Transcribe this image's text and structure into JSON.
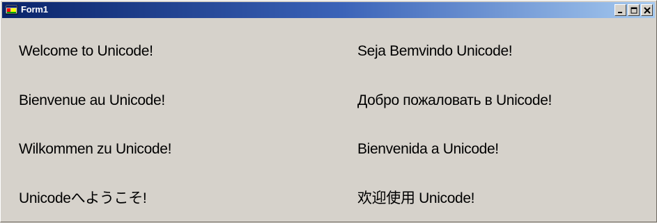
{
  "window": {
    "title": "Form1",
    "icon": "app-form-icon",
    "controls": {
      "minimize_icon": "minimize-icon",
      "maximize_icon": "maximize-icon",
      "close_icon": "close-icon"
    }
  },
  "greetings": {
    "left": [
      "Welcome to Unicode!",
      "Bienvenue au Unicode!",
      "Wilkommen zu Unicode!",
      "Unicodeへようこそ!"
    ],
    "right": [
      "Seja Bemvindo Unicode!",
      "Добро пожаловать в Unicode!",
      "Bienvenida a Unicode!",
      "欢迎使用 Unicode!"
    ]
  }
}
